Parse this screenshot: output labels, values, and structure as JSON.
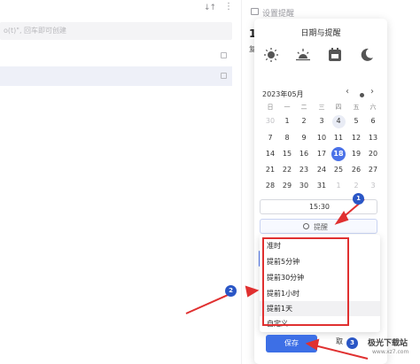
{
  "left_pane": {
    "input_placeholder": "o(t)\", 回车即可创建",
    "sort_glyph": "↓↑",
    "more_glyph": "⋮"
  },
  "toolbar": {
    "reminder_label": "设置提醒"
  },
  "background": {
    "digit": "1",
    "text2": "复"
  },
  "popup": {
    "title": "日期与提醒",
    "quick_icons": [
      "sun-icon",
      "sunset-icon",
      "calendar-icon",
      "moon-icon"
    ],
    "month_label": "2023年05月",
    "nav_prev": "‹",
    "nav_next": "›",
    "weekdays": [
      "日",
      "一",
      "二",
      "三",
      "四",
      "五",
      "六"
    ],
    "days": [
      [
        "30",
        "1",
        "2",
        "3",
        "4",
        "5",
        "6"
      ],
      [
        "7",
        "8",
        "9",
        "10",
        "11",
        "12",
        "13"
      ],
      [
        "14",
        "15",
        "16",
        "17",
        "18",
        "19",
        "20"
      ],
      [
        "21",
        "22",
        "23",
        "24",
        "25",
        "26",
        "27"
      ],
      [
        "28",
        "29",
        "30",
        "31",
        "1",
        "2",
        "3"
      ]
    ],
    "today": "4",
    "selected": "18",
    "time": "15:30",
    "reminder": "提醒"
  },
  "dropdown": {
    "options": [
      "准时",
      "提前5分钟",
      "提前30分钟",
      "提前1小时",
      "提前1天",
      "自定义"
    ],
    "highlighted": "提前1天"
  },
  "actions": {
    "save": "保存",
    "cancel": "取"
  },
  "annotations": {
    "badge1": "1",
    "badge2": "2",
    "badge3": "3"
  },
  "watermark": {
    "text": "极光下载站",
    "sub": "www.xz7.com"
  },
  "colors": {
    "accent": "#3d6fe6",
    "annotation": "#e03030"
  }
}
